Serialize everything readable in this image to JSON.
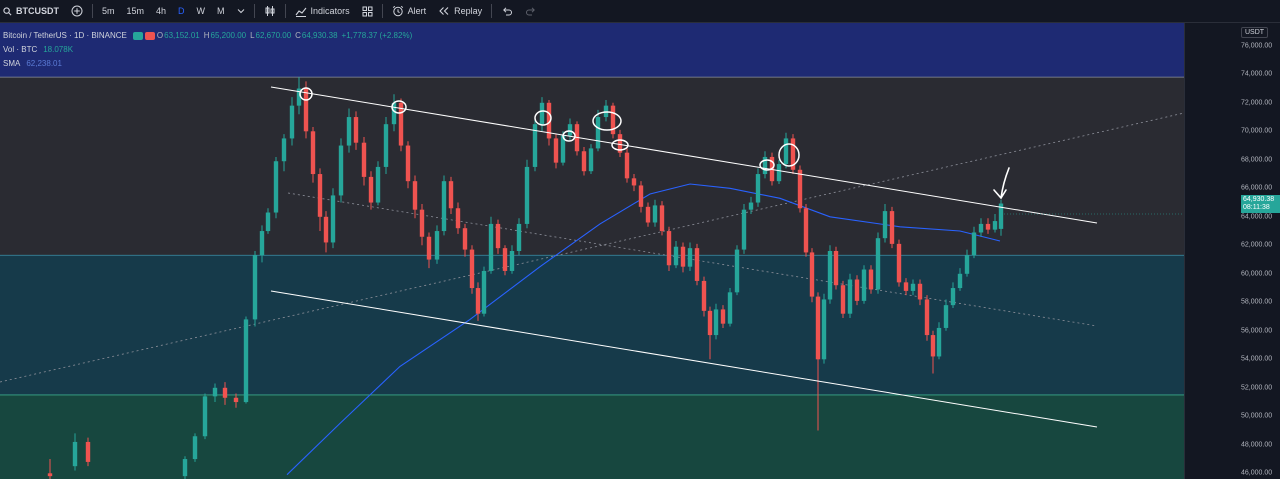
{
  "toolbar": {
    "symbol": "BTCUSDT",
    "intervals": [
      "5m",
      "15m",
      "4h",
      "D",
      "W",
      "M"
    ],
    "active_interval": "D",
    "indicators_label": "Indicators",
    "alert_label": "Alert",
    "replay_label": "Replay"
  },
  "legend": {
    "title": "Bitcoin / TetherUS · 1D · BINANCE",
    "ohlc": [
      {
        "key": "O",
        "value": "63,152.01"
      },
      {
        "key": "H",
        "value": "65,200.00"
      },
      {
        "key": "L",
        "value": "62,670.00"
      },
      {
        "key": "C",
        "value": "64,930.38"
      }
    ],
    "change": "+1,778.37 (+2.82%)",
    "vol_label": "Vol · BTC",
    "vol_value": "18.078K",
    "sma_label": "SMA",
    "sma_value": "62,238.01"
  },
  "axis": {
    "unit": "USDT",
    "last_price": "64,930.38",
    "countdown": "08:11:38"
  },
  "colors": {
    "up": "#26a69a",
    "down": "#ef5350",
    "sma": "#2962ff",
    "background": "#131722"
  },
  "chart_data": {
    "type": "candlestick",
    "ylim": [
      45600,
      77600
    ],
    "yticks": [
      46000,
      48000,
      50000,
      52000,
      54000,
      56000,
      58000,
      60000,
      62000,
      64000,
      66000,
      68000,
      70000,
      72000,
      74000,
      76000
    ],
    "ytick_labels": [
      "46,000.00",
      "48,000.00",
      "50,000.00",
      "52,000.00",
      "54,000.00",
      "56,000.00",
      "58,000.00",
      "60,000.00",
      "62,000.00",
      "64,000.00",
      "66,000.00",
      "68,000.00",
      "70,000.00",
      "72,000.00",
      "74,000.00",
      "76,000.00"
    ],
    "last_close": 64930.38,
    "zones": [
      {
        "from": 73800,
        "to": 77600,
        "color": "#1e2a73"
      },
      {
        "from": 61300,
        "to": 73800,
        "color": "#2a2b32"
      },
      {
        "from": 51500,
        "to": 61300,
        "color": "#163a4a"
      },
      {
        "from": 45600,
        "to": 51500,
        "color": "#17473f"
      }
    ],
    "sma_points": [
      [
        287,
        45900
      ],
      [
        340,
        49500
      ],
      [
        400,
        53500
      ],
      [
        470,
        56800
      ],
      [
        540,
        60500
      ],
      [
        600,
        63500
      ],
      [
        650,
        65600
      ],
      [
        690,
        66300
      ],
      [
        730,
        66000
      ],
      [
        780,
        65300
      ],
      [
        830,
        64000
      ],
      [
        900,
        63300
      ],
      [
        960,
        63000
      ],
      [
        1000,
        62300
      ]
    ],
    "candles": [
      [
        50,
        46000,
        45800,
        47000,
        45500
      ],
      [
        75,
        46500,
        48200,
        48800,
        46200
      ],
      [
        88,
        48200,
        46800,
        48500,
        46500
      ],
      [
        185,
        45800,
        47000,
        47200,
        45600
      ],
      [
        195,
        47000,
        48600,
        48800,
        46800
      ],
      [
        205,
        48600,
        51400,
        51600,
        48400
      ],
      [
        215,
        51400,
        52000,
        52300,
        51000
      ],
      [
        225,
        52000,
        51300,
        52400,
        50800
      ],
      [
        236,
        51300,
        51000,
        51600,
        50600
      ],
      [
        246,
        51000,
        56800,
        57000,
        50900
      ],
      [
        255,
        56800,
        61300,
        61600,
        56300
      ],
      [
        262,
        61300,
        63000,
        63400,
        60800
      ],
      [
        268,
        63000,
        64300,
        64600,
        62800
      ],
      [
        276,
        64300,
        67900,
        68200,
        63900
      ],
      [
        284,
        67900,
        69500,
        69800,
        67200
      ],
      [
        292,
        69500,
        71800,
        72400,
        69000
      ],
      [
        299,
        71800,
        73000,
        73800,
        71200
      ],
      [
        306,
        73000,
        70000,
        73500,
        69500
      ],
      [
        313,
        70000,
        67000,
        70300,
        66400
      ],
      [
        320,
        67000,
        64000,
        67400,
        63000
      ],
      [
        326,
        64000,
        62200,
        64400,
        61500
      ],
      [
        333,
        62200,
        65500,
        66000,
        61800
      ],
      [
        341,
        65500,
        69000,
        69500,
        65000
      ],
      [
        349,
        69000,
        71000,
        71600,
        68500
      ],
      [
        356,
        71000,
        69200,
        71400,
        68700
      ],
      [
        364,
        69200,
        66800,
        69600,
        66200
      ],
      [
        371,
        66800,
        65000,
        67200,
        64500
      ],
      [
        378,
        65000,
        67500,
        67900,
        64800
      ],
      [
        386,
        67500,
        70500,
        71000,
        67000
      ],
      [
        394,
        70500,
        72000,
        72600,
        70000
      ],
      [
        401,
        72000,
        69000,
        72300,
        68600
      ],
      [
        408,
        69000,
        66500,
        69300,
        66000
      ],
      [
        415,
        66500,
        64500,
        66900,
        63900
      ],
      [
        422,
        64500,
        62600,
        64900,
        62000
      ],
      [
        429,
        62600,
        61000,
        62900,
        60400
      ],
      [
        437,
        61000,
        63000,
        63400,
        60700
      ],
      [
        444,
        63000,
        66500,
        66900,
        62700
      ],
      [
        451,
        66500,
        64600,
        66800,
        64200
      ],
      [
        458,
        64600,
        63200,
        65000,
        62800
      ],
      [
        465,
        63200,
        61700,
        63500,
        61200
      ],
      [
        472,
        61700,
        59000,
        62000,
        58600
      ],
      [
        478,
        59000,
        57200,
        59400,
        56700
      ],
      [
        484,
        57200,
        60200,
        60500,
        57000
      ],
      [
        491,
        60200,
        63500,
        64000,
        60000
      ],
      [
        498,
        63500,
        61800,
        63800,
        61400
      ],
      [
        505,
        61800,
        60200,
        62000,
        59900
      ],
      [
        512,
        60200,
        61600,
        62000,
        60000
      ],
      [
        519,
        61600,
        63500,
        63900,
        61300
      ],
      [
        527,
        63500,
        67500,
        68000,
        63200
      ],
      [
        535,
        67500,
        70500,
        71000,
        67200
      ],
      [
        542,
        70500,
        72000,
        72400,
        70000
      ],
      [
        549,
        72000,
        69500,
        72200,
        69000
      ],
      [
        556,
        69500,
        67800,
        69800,
        67400
      ],
      [
        563,
        67800,
        69700,
        70000,
        67600
      ],
      [
        570,
        69700,
        70500,
        70900,
        69400
      ],
      [
        577,
        70500,
        68600,
        70700,
        68300
      ],
      [
        584,
        68600,
        67200,
        68900,
        66900
      ],
      [
        591,
        67200,
        68800,
        69100,
        67000
      ],
      [
        598,
        68800,
        71000,
        71500,
        68600
      ],
      [
        606,
        71000,
        71800,
        72200,
        70700
      ],
      [
        613,
        71800,
        69800,
        72000,
        69500
      ],
      [
        620,
        69800,
        68500,
        70100,
        68200
      ],
      [
        627,
        68500,
        66700,
        68800,
        66400
      ],
      [
        634,
        66700,
        66200,
        67000,
        65800
      ],
      [
        641,
        66200,
        64700,
        66500,
        64300
      ],
      [
        648,
        64700,
        63600,
        65000,
        63300
      ],
      [
        655,
        63600,
        64800,
        65200,
        63300
      ],
      [
        662,
        64800,
        63000,
        65100,
        62700
      ],
      [
        669,
        63000,
        60600,
        63300,
        60200
      ],
      [
        676,
        60600,
        61900,
        62300,
        60400
      ],
      [
        683,
        61900,
        60500,
        62200,
        60100
      ],
      [
        690,
        60500,
        61800,
        62200,
        60200
      ],
      [
        697,
        61800,
        59500,
        62100,
        59200
      ],
      [
        704,
        59500,
        57400,
        59800,
        57000
      ],
      [
        710,
        57400,
        55700,
        57700,
        54000
      ],
      [
        716,
        55700,
        57500,
        57900,
        55400
      ],
      [
        723,
        57500,
        56500,
        57800,
        56200
      ],
      [
        730,
        56500,
        58700,
        59000,
        56300
      ],
      [
        737,
        58700,
        61700,
        62000,
        58500
      ],
      [
        744,
        61700,
        64500,
        64900,
        61400
      ],
      [
        751,
        64500,
        65000,
        65400,
        64200
      ],
      [
        758,
        65000,
        67000,
        67400,
        64700
      ],
      [
        765,
        67000,
        68200,
        68600,
        66700
      ],
      [
        772,
        68200,
        66500,
        68500,
        66200
      ],
      [
        779,
        66500,
        67700,
        68000,
        66300
      ],
      [
        786,
        67700,
        69500,
        69900,
        67400
      ],
      [
        793,
        69500,
        67300,
        69800,
        67000
      ],
      [
        800,
        67300,
        64600,
        67600,
        64300
      ],
      [
        806,
        64600,
        61500,
        64900,
        61200
      ],
      [
        812,
        61500,
        58400,
        61800,
        58000
      ],
      [
        818,
        58400,
        54000,
        58700,
        49000
      ],
      [
        824,
        54000,
        58200,
        58600,
        53700
      ],
      [
        830,
        58200,
        61600,
        62000,
        57900
      ],
      [
        836,
        61600,
        59200,
        61900,
        58900
      ],
      [
        843,
        59200,
        57200,
        59500,
        56900
      ],
      [
        850,
        57200,
        59600,
        60000,
        56900
      ],
      [
        857,
        59600,
        58100,
        59900,
        57800
      ],
      [
        864,
        58100,
        60300,
        60600,
        57900
      ],
      [
        871,
        60300,
        58900,
        60600,
        58600
      ],
      [
        878,
        58900,
        62500,
        62900,
        58600
      ],
      [
        885,
        62500,
        64400,
        64900,
        62200
      ],
      [
        892,
        64400,
        62100,
        64700,
        61800
      ],
      [
        899,
        62100,
        59400,
        62400,
        59100
      ],
      [
        906,
        59400,
        58800,
        59700,
        58500
      ],
      [
        913,
        58800,
        59300,
        59600,
        58500
      ],
      [
        920,
        59300,
        58200,
        59600,
        57800
      ],
      [
        927,
        58200,
        55700,
        58500,
        55300
      ],
      [
        933,
        55700,
        54200,
        56000,
        53000
      ],
      [
        939,
        54200,
        56200,
        56600,
        54000
      ],
      [
        946,
        56200,
        57800,
        58200,
        56000
      ],
      [
        953,
        57800,
        59000,
        59400,
        57600
      ],
      [
        960,
        59000,
        60000,
        60400,
        58800
      ],
      [
        967,
        60000,
        61300,
        61700,
        59800
      ],
      [
        974,
        61300,
        62900,
        63300,
        61100
      ],
      [
        981,
        62900,
        63500,
        63900,
        62600
      ],
      [
        988,
        63500,
        63100,
        63900,
        62800
      ],
      [
        995,
        63100,
        63700,
        64200,
        62900
      ],
      [
        1001,
        63152,
        64930,
        65200,
        62670
      ]
    ]
  }
}
